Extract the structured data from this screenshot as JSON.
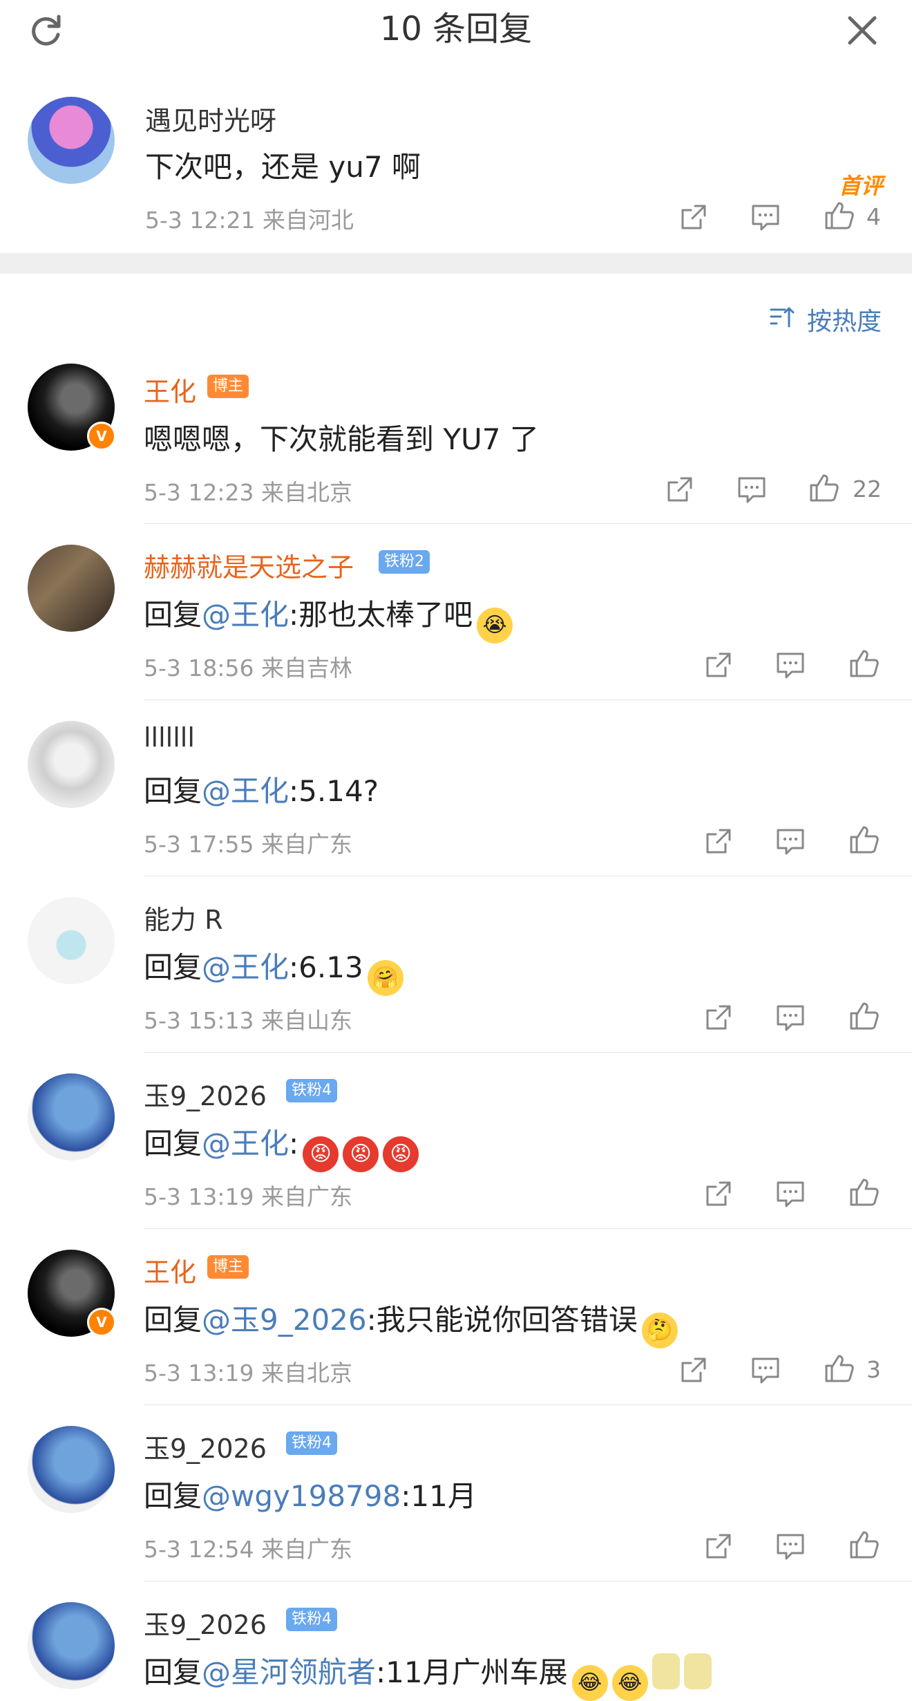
{
  "header": {
    "title": "10 条回复"
  },
  "root_comment": {
    "name": "遇见时光呀",
    "text": "下次吧，还是 yu7 啊",
    "time": "5-3 12:21",
    "location": "来自河北",
    "like_count": "4",
    "first_badge": "首评"
  },
  "sort": {
    "label": "按热度"
  },
  "replies": [
    {
      "name": "王化",
      "badge": "博主",
      "text": "嗯嗯嗯，下次就能看到 YU7 了",
      "time": "5-3 12:23",
      "location": "来自北京",
      "like_count": "22"
    },
    {
      "name": "赫赫就是天选之子",
      "badge": "铁粉2",
      "prefix": "回复",
      "mention": "@王化",
      "text": ":那也太棒了吧",
      "time": "5-3 18:56",
      "location": "来自吉林"
    },
    {
      "name": "lllllll",
      "prefix": "回复",
      "mention": "@王化",
      "text": ":5.14?",
      "time": "5-3 17:55",
      "location": "来自广东"
    },
    {
      "name": "能力 R",
      "prefix": "回复",
      "mention": "@王化",
      "text": ":6.13",
      "time": "5-3 15:13",
      "location": "来自山东"
    },
    {
      "name": "玉9_2026",
      "badge": "铁粉4",
      "prefix": "回复",
      "mention": "@王化",
      "text": ":",
      "time": "5-3 13:19",
      "location": "来自广东"
    },
    {
      "name": "王化",
      "badge": "博主",
      "prefix": "回复",
      "mention": "@玉9_2026",
      "text": ":我只能说你回答错误",
      "time": "5-3 13:19",
      "location": "来自北京",
      "like_count": "3"
    },
    {
      "name": "玉9_2026",
      "badge": "铁粉4",
      "prefix": "回复",
      "mention": "@wgy198798",
      "text": ":11月",
      "time": "5-3 12:54",
      "location": "来自广东"
    },
    {
      "name": "玉9_2026",
      "badge": "铁粉4",
      "prefix": "回复",
      "mention": "@星河领航者",
      "text": ":11月广州车展",
      "time": "",
      "location": ""
    }
  ],
  "colors": {
    "accent_blue": "#4a7db8",
    "name_orange": "#e8641b",
    "boss_badge": "#ff8a33",
    "fan_badge": "#6aa8ef",
    "verified": "#ff8200"
  }
}
